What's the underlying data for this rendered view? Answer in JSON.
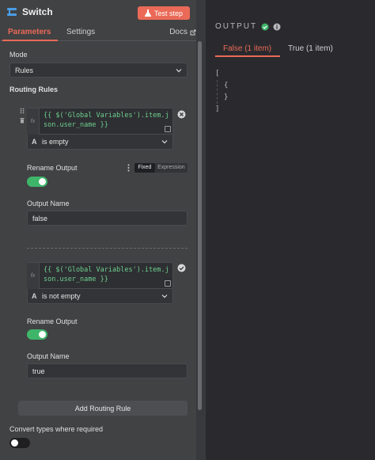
{
  "node": {
    "title": "Switch",
    "test_label": "Test step"
  },
  "tabs": {
    "parameters": "Parameters",
    "settings": "Settings",
    "docs": "Docs"
  },
  "mode": {
    "label": "Mode",
    "value": "Rules"
  },
  "routing_rules": {
    "label": "Routing Rules",
    "rules": [
      {
        "expression": "{{ $('Global Variables').item.json.user_name }}",
        "condition": "is empty",
        "rename_label": "Rename Output",
        "rename_on": true,
        "output_name_label": "Output Name",
        "output_name": "false"
      },
      {
        "expression": "{{ $('Global Variables').item.json.user_name }}",
        "condition": "is not empty",
        "rename_label": "Rename Output",
        "rename_on": true,
        "output_name_label": "Output Name",
        "output_name": "true"
      }
    ],
    "fixed_label": "Fixed",
    "expression_label": "Expression",
    "add_rule_label": "Add Routing Rule"
  },
  "convert": {
    "label": "Convert types where required",
    "on": false
  },
  "output": {
    "title": "OUTPUT",
    "tabs": [
      "False (1 item)",
      "True (1 item)"
    ],
    "json_lines": [
      "[",
      "{",
      "}",
      "]"
    ]
  },
  "colors": {
    "accent": "#ea6a57",
    "toggle_on": "#3fb56a",
    "code": "#6dcf8d"
  }
}
